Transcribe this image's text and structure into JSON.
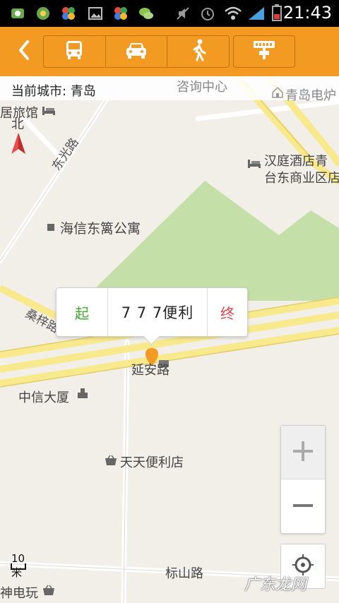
{
  "status_bar": {
    "time": "21:43",
    "icons": [
      "app-notification-icon",
      "app-notification-icon",
      "clover-icon",
      "image-icon",
      "clover-icon",
      "wechat-icon",
      "mute-icon",
      "alarm-icon",
      "wifi-icon",
      "signal-icon",
      "battery-icon"
    ]
  },
  "toolbar": {
    "back_icon": "chevron-left-icon",
    "modes": [
      "bus-icon",
      "taxi-icon",
      "walk-icon"
    ],
    "station_icon": "bus-stop-icon",
    "accent_color": "#f39a22"
  },
  "map": {
    "current_city": "当前城市: 青岛",
    "labels": {
      "consult_center": "咨询中心",
      "qingdao_tv": "青岛电炉",
      "hostel": "居旅馆",
      "north": "北",
      "dongguang_road": "东光路",
      "hanting_line1": "汉庭酒店青",
      "hanting_line2": "台东商业区店",
      "hisense_apartment": "海信东篱公寓",
      "sangzi_road": "桑梓路",
      "yanan_road": "延安路",
      "citic_building": "中信大厦",
      "tiantian_store": "天天便利店",
      "biaoshan_road": "标山路",
      "electronic_toy": "神电玩"
    },
    "scale": "10米",
    "watermark": "广东龙网"
  },
  "popup": {
    "start_label": "起",
    "place_name": "7 7 7便利",
    "end_label": "终"
  },
  "controls": {
    "zoom_in_icon": "plus-icon",
    "zoom_out_icon": "minus-icon",
    "locate_icon": "crosshair-icon"
  }
}
